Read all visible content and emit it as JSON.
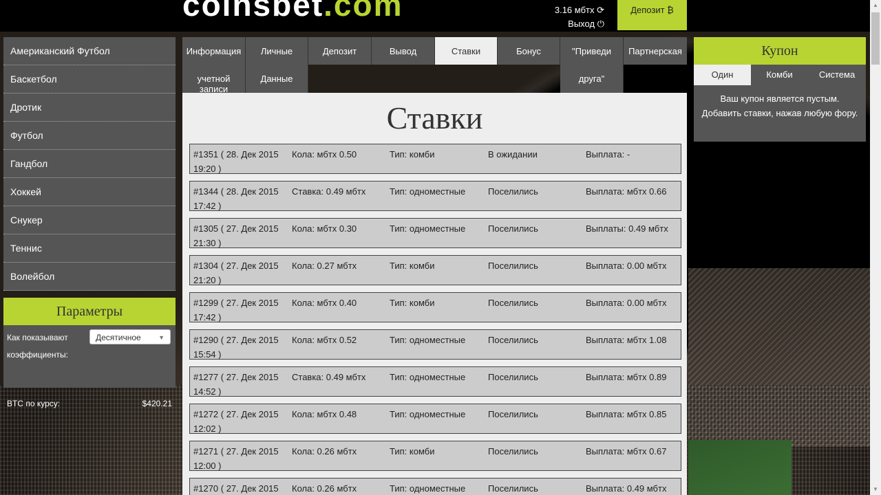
{
  "header": {
    "logo_main": "coinsbet",
    "logo_com": ".com",
    "balance": "3.16 мбтх",
    "refresh_glyph": "⟳",
    "logout": "Выход",
    "logout_glyph": "⏻",
    "deposit_button": "Депозит ₿"
  },
  "sports": [
    "Американский Футбол",
    "Баскетбол",
    "Дротик",
    "Футбол",
    "Гандбол",
    "Хоккей",
    "Снукер",
    "Теннис",
    "Волейбол"
  ],
  "params": {
    "title": "Параметры",
    "odds_label": "Как показывают коэффициенты:",
    "odds_value": "Десятичное",
    "btc_label": "BTC по курсу:",
    "btc_value": "$420.21"
  },
  "tabs": [
    {
      "l1": "Информация",
      "l2": "учетной записи"
    },
    {
      "l1": "Личные",
      "l2": "Данные"
    },
    {
      "l1": "Депозит",
      "l2": ""
    },
    {
      "l1": "Вывод",
      "l2": ""
    },
    {
      "l1": "Ставки",
      "l2": ""
    },
    {
      "l1": "Бонус",
      "l2": ""
    },
    {
      "l1": "\"Приведи",
      "l2": "друга\""
    },
    {
      "l1": "Партнерская",
      "l2": ""
    }
  ],
  "page_title": "Ставки",
  "bets": [
    {
      "id": "#1351 ( 28. Дек 2015",
      "time": "19:20 )",
      "amount": "Кола: мбтх 0.50",
      "type": "Тип: комби",
      "status": "В ожидании",
      "payout": "Выплата: -"
    },
    {
      "id": "#1344 ( 28. Дек 2015",
      "time": "17:42 )",
      "amount": "Ставка: 0.49 мбтх",
      "type": "Тип: одноместные",
      "status": "Поселились",
      "payout": "Выплата: мбтх 0.66"
    },
    {
      "id": "#1305 ( 27. Дек 2015",
      "time": "21:30 )",
      "amount": "Кола: мбтх 0.30",
      "type": "Тип: одноместные",
      "status": "Поселились",
      "payout": "Выплаты: 0.49 мбтх"
    },
    {
      "id": "#1304 ( 27. Дек 2015",
      "time": "21:20 )",
      "amount": "Кола: 0.27 мбтх",
      "type": "Тип: комби",
      "status": "Поселились",
      "payout": "Выплата: 0.00 мбтх"
    },
    {
      "id": "#1299 ( 27. Дек 2015",
      "time": "17:42 )",
      "amount": "Кола: мбтх 0.40",
      "type": "Тип: комби",
      "status": "Поселились",
      "payout": "Выплата: 0.00 мбтх"
    },
    {
      "id": "#1290 ( 27. Дек 2015",
      "time": "15:54 )",
      "amount": "Кола: мбтх 0.52",
      "type": "Тип: одноместные",
      "status": "Поселились",
      "payout": "Выплата: мбтх 1.08"
    },
    {
      "id": "#1277 ( 27. Дек 2015",
      "time": "14:52 )",
      "amount": "Ставка: 0.49 мбтх",
      "type": "Тип: одноместные",
      "status": "Поселились",
      "payout": "Выплата: мбтх 0.89"
    },
    {
      "id": "#1272 ( 27. Дек 2015",
      "time": "12:02 )",
      "amount": "Кола: мбтх 0.48",
      "type": "Тип: одноместные",
      "status": "Поселились",
      "payout": "Выплата: мбтх 0.85"
    },
    {
      "id": "#1271 ( 27. Дек 2015",
      "time": "12:00 )",
      "amount": "Кола: 0.26 мбтх",
      "type": "Тип: комби",
      "status": "Поселились",
      "payout": "Выплата: мбтх 0.67"
    },
    {
      "id": "#1270 ( 27. Дек 2015",
      "time": "",
      "amount": "Кола: 0.26 мбтх",
      "type": "Тип: одноместные",
      "status": "Поселились",
      "payout": "Выплата: 0.49 мбтх"
    }
  ],
  "coupon": {
    "title": "Купон",
    "tabs": [
      "Один",
      "Комби",
      "Система"
    ],
    "empty_line1": "Ваш купон является пустым.",
    "empty_line2": "Добавить ставки, нажав любую фору."
  },
  "colors": {
    "accent": "#b8d432",
    "panel": "#555555"
  }
}
